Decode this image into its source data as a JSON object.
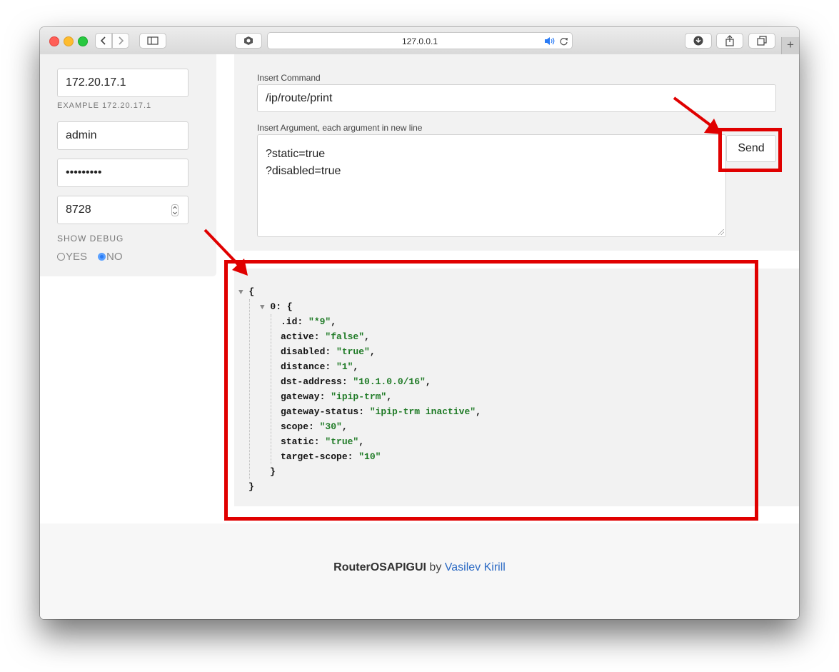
{
  "browser": {
    "url": "127.0.0.1",
    "colors": {
      "close": "#ff5f57",
      "minimize": "#febc2e",
      "zoom": "#28c840"
    }
  },
  "sidebar": {
    "host_value": "172.20.17.1",
    "host_hint": "EXAMPLE 172.20.17.1",
    "user_value": "admin",
    "password_value": "•••••••••",
    "port_value": "8728",
    "debug_label": "SHOW DEBUG",
    "debug_yes": "YES",
    "debug_no": "NO"
  },
  "command": {
    "command_label": "Insert Command",
    "command_value": "/ip/route/print",
    "args_label": "Insert Argument, each argument in new line",
    "args_line1": "?static=true",
    "args_line2": "?disabled=true",
    "send_label": "Send"
  },
  "output": {
    "open_brace": "{",
    "item_key": "0: {",
    "fields": [
      {
        "key": ".id: ",
        "value": "\"*9\"",
        "comma": ","
      },
      {
        "key": "active: ",
        "value": "\"false\"",
        "comma": ","
      },
      {
        "key": "disabled: ",
        "value": "\"true\"",
        "comma": ","
      },
      {
        "key": "distance: ",
        "value": "\"1\"",
        "comma": ","
      },
      {
        "key": "dst-address: ",
        "value": "\"10.1.0.0/16\"",
        "comma": ","
      },
      {
        "key": "gateway: ",
        "value": "\"ipip-trm\"",
        "comma": ","
      },
      {
        "key": "gateway-status: ",
        "value": "\"ipip-trm inactive\"",
        "comma": ","
      },
      {
        "key": "scope: ",
        "value": "\"30\"",
        "comma": ","
      },
      {
        "key": "static: ",
        "value": "\"true\"",
        "comma": ","
      },
      {
        "key": "target-scope: ",
        "value": "\"10\"",
        "comma": ""
      }
    ],
    "item_close": "}",
    "close_brace": "}"
  },
  "footer": {
    "app_name": "RouterOSAPIGUI",
    "by": " by ",
    "author": "Vasilev Kirill"
  },
  "annotation_color": "#e00000"
}
